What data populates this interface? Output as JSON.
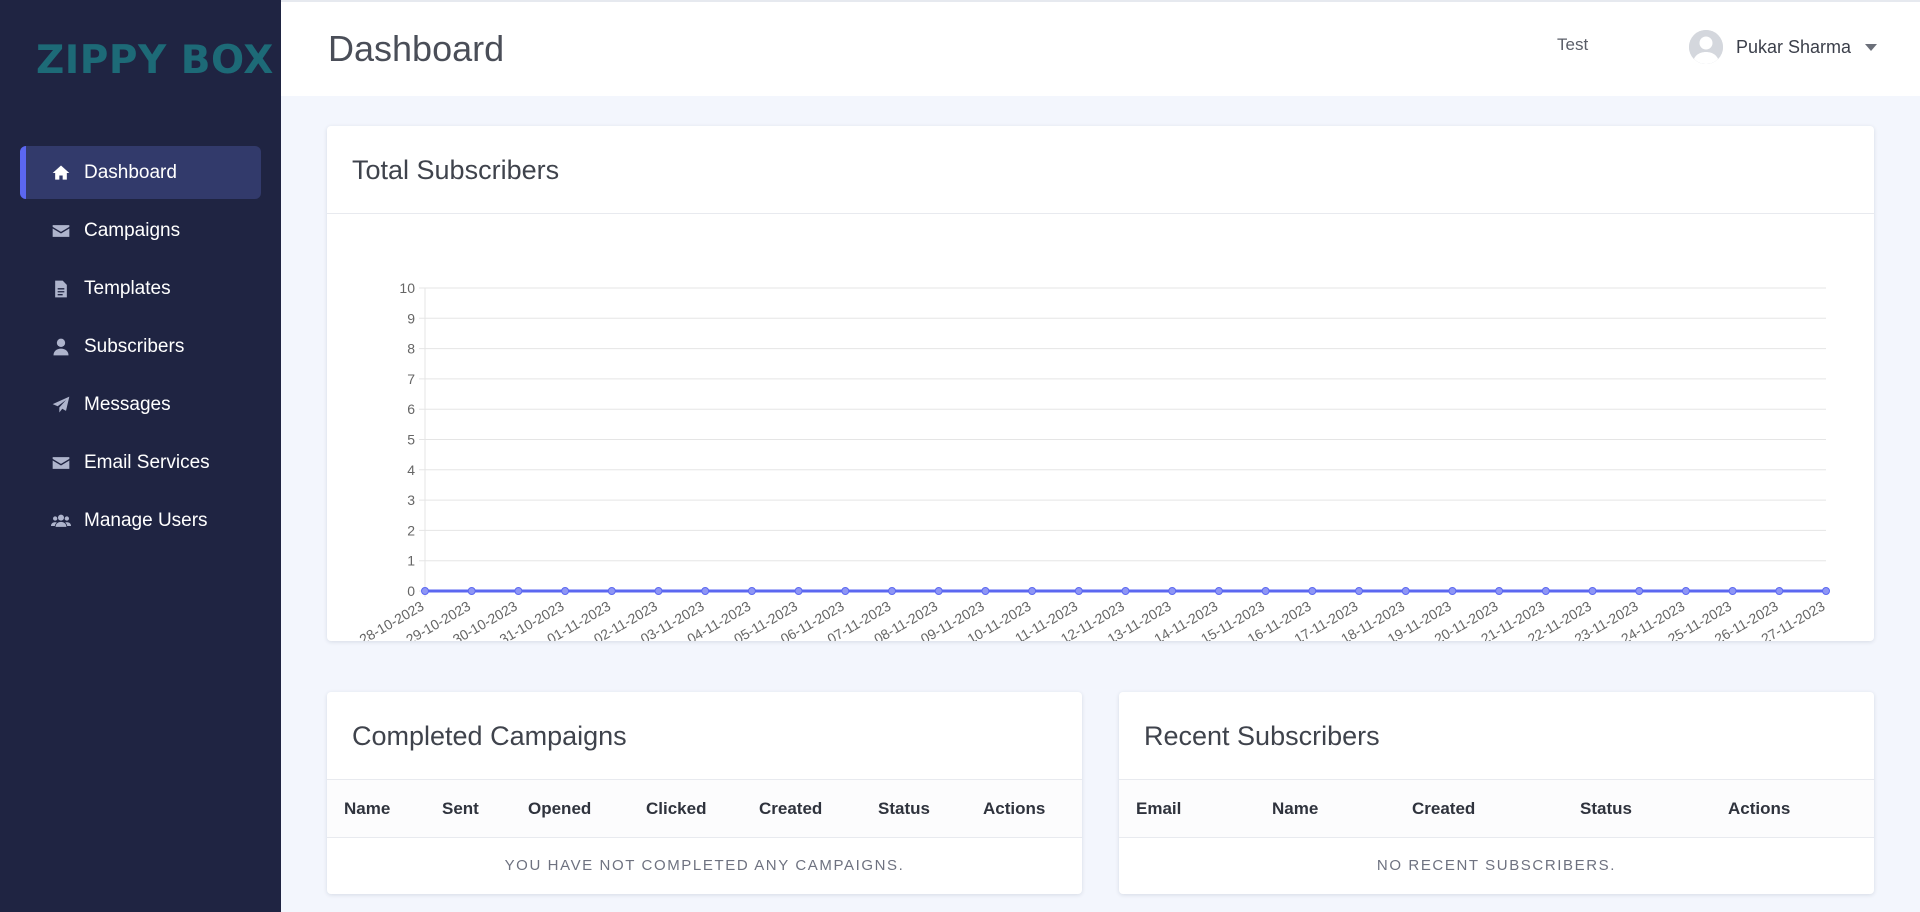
{
  "brand": {
    "logo_text": "ZIPPY BOX"
  },
  "sidebar": {
    "items": [
      {
        "label": "Dashboard",
        "icon": "home-icon",
        "active": true
      },
      {
        "label": "Campaigns",
        "icon": "envelope-icon"
      },
      {
        "label": "Templates",
        "icon": "document-icon"
      },
      {
        "label": "Subscribers",
        "icon": "user-icon"
      },
      {
        "label": "Messages",
        "icon": "paper-plane-icon"
      },
      {
        "label": "Email Services",
        "icon": "envelope-icon"
      },
      {
        "label": "Manage Users",
        "icon": "users-icon"
      }
    ]
  },
  "header": {
    "title": "Dashboard",
    "test_link": "Test",
    "user_name": "Pukar Sharma"
  },
  "subscribers_card": {
    "title": "Total Subscribers"
  },
  "chart_data": {
    "type": "line",
    "title": "Total Subscribers",
    "x": [
      "28-10-2023",
      "29-10-2023",
      "30-10-2023",
      "31-10-2023",
      "01-11-2023",
      "02-11-2023",
      "03-11-2023",
      "04-11-2023",
      "05-11-2023",
      "06-11-2023",
      "07-11-2023",
      "08-11-2023",
      "09-11-2023",
      "10-11-2023",
      "11-11-2023",
      "12-11-2023",
      "13-11-2023",
      "14-11-2023",
      "15-11-2023",
      "16-11-2023",
      "17-11-2023",
      "18-11-2023",
      "19-11-2023",
      "20-11-2023",
      "21-11-2023",
      "22-11-2023",
      "23-11-2023",
      "24-11-2023",
      "25-11-2023",
      "26-11-2023",
      "27-11-2023"
    ],
    "series": [
      {
        "values": [
          0,
          0,
          0,
          0,
          0,
          0,
          0,
          0,
          0,
          0,
          0,
          0,
          0,
          0,
          0,
          0,
          0,
          0,
          0,
          0,
          0,
          0,
          0,
          0,
          0,
          0,
          0,
          0,
          0,
          0,
          0
        ]
      }
    ],
    "ylim": [
      0,
      10
    ],
    "yticks": [
      0,
      1,
      2,
      3,
      4,
      5,
      6,
      7,
      8,
      9,
      10
    ],
    "grid": true,
    "line_color": "#5b67f1"
  },
  "campaigns": {
    "title": "Completed Campaigns",
    "columns": [
      "Name",
      "Sent",
      "Opened",
      "Clicked",
      "Created",
      "Status",
      "Actions"
    ],
    "empty_text": "YOU HAVE NOT COMPLETED ANY CAMPAIGNS."
  },
  "recent_subscribers": {
    "title": "Recent Subscribers",
    "columns": [
      "Email",
      "Name",
      "Created",
      "Status",
      "Actions"
    ],
    "empty_text": "NO RECENT SUBSCRIBERS."
  }
}
